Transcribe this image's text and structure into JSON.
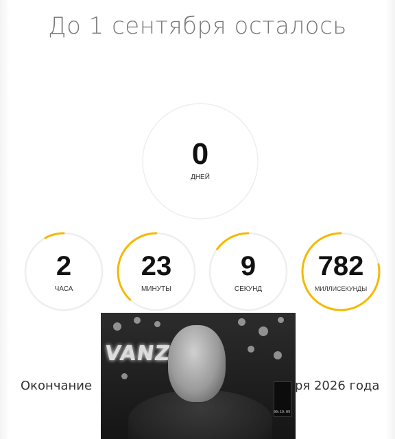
{
  "title": "До 1 сентября осталось",
  "countdown": {
    "days": {
      "value": "0",
      "unit": "ДНЕЙ",
      "progress": 0
    },
    "hours": {
      "value": "2",
      "unit": "ЧАСА",
      "progress": 0.08
    },
    "minutes": {
      "value": "23",
      "unit": "МИНУТЫ",
      "progress": 0.38
    },
    "seconds": {
      "value": "9",
      "unit": "СЕКУНД",
      "progress": 0.15
    },
    "ms": {
      "value": "782",
      "unit": "МИЛЛИСЕКУНДЫ",
      "progress": 0.78
    }
  },
  "footer": {
    "left": "Окончание",
    "right": "ря 2026 года"
  },
  "video": {
    "sign": "VANZ",
    "screen_text": "00:19:09"
  },
  "colors": {
    "accent": "#f5b800",
    "track": "#eeeeee",
    "title": "#777777"
  }
}
